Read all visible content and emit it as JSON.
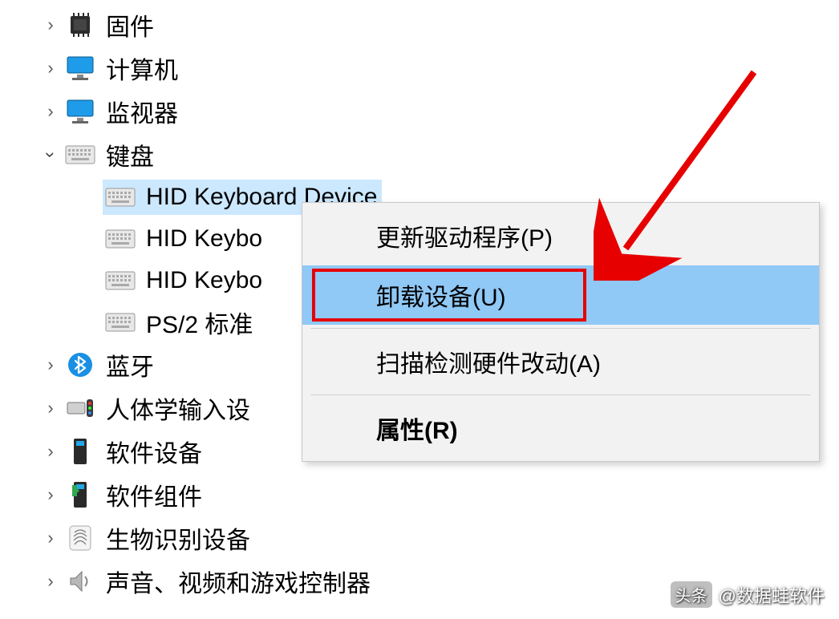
{
  "tree": {
    "firmware": "固件",
    "computer": "计算机",
    "monitor": "监视器",
    "keyboard": "键盘",
    "kb_child_1": "HID Keyboard Device",
    "kb_child_2": "HID Keybo",
    "kb_child_3": "HID Keybo",
    "kb_child_4": "PS/2 标准",
    "bluetooth": "蓝牙",
    "hid": "人体学输入设",
    "softdev": "软件设备",
    "softcomp": "软件组件",
    "biometric": "生物识别设备",
    "sound": "声音、视频和游戏控制器"
  },
  "menu": {
    "update": "更新驱动程序(P)",
    "uninstall": "卸载设备(U)",
    "scan": "扫描检测硬件改动(A)",
    "properties": "属性(R)"
  },
  "watermark": {
    "badge": "头条",
    "text": "@数据蛙软件"
  }
}
